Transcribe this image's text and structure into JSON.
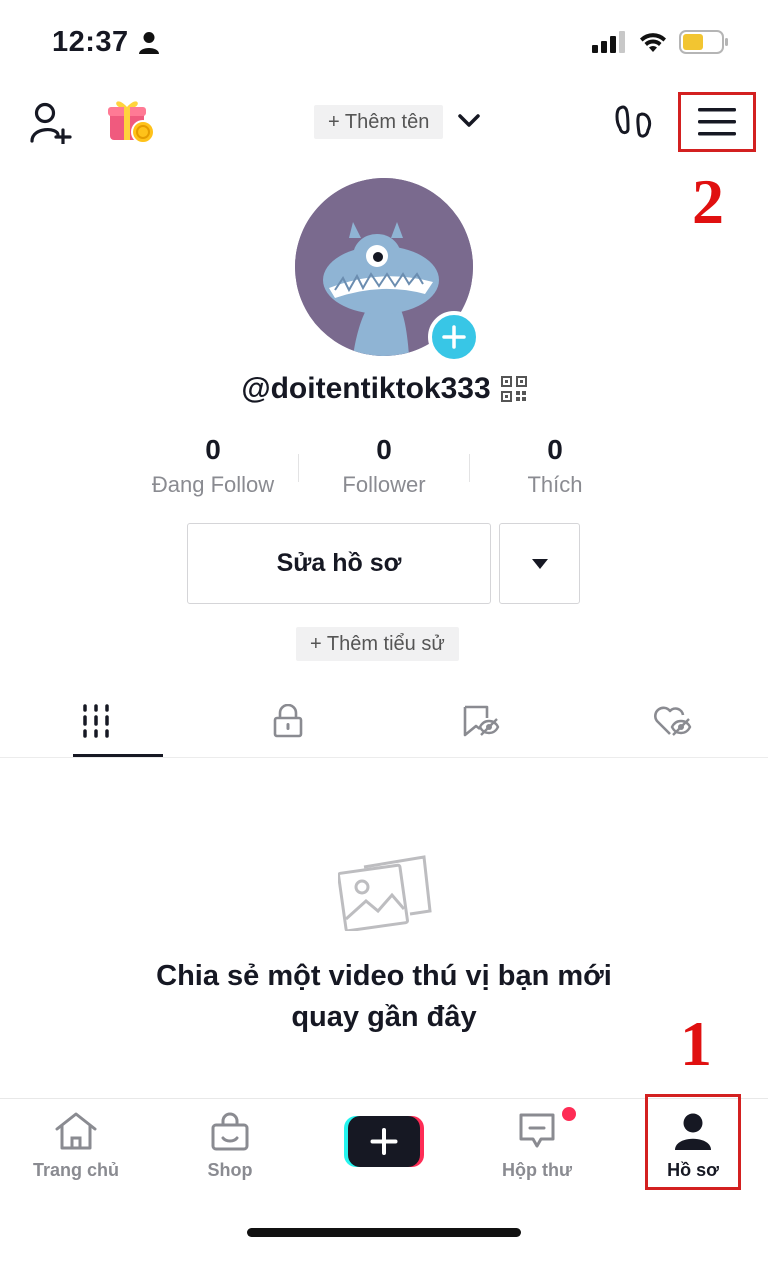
{
  "status_bar": {
    "time": "12:37"
  },
  "header": {
    "add_name_label": "+ Thêm tên",
    "annotation_menu": "2"
  },
  "profile": {
    "username": "@doitentiktok333",
    "stats": [
      {
        "value": "0",
        "label": "Đang Follow"
      },
      {
        "value": "0",
        "label": "Follower"
      },
      {
        "value": "0",
        "label": "Thích"
      }
    ],
    "edit_profile_label": "Sửa hồ sơ",
    "add_bio_label": "+ Thêm tiểu sử"
  },
  "tabs": [
    "videos-grid-icon",
    "lock-icon",
    "bookmark-hidden-icon",
    "liked-hidden-icon"
  ],
  "empty_state": {
    "line1": "Chia sẻ một video thú vị bạn mới",
    "line2": "quay gần đây"
  },
  "bottom_nav": {
    "home": "Trang chủ",
    "shop": "Shop",
    "inbox": "Hộp thư",
    "profile": "Hồ sơ",
    "annotation_profile": "1"
  },
  "colors": {
    "accent_blue": "#38c6e6",
    "annotation_red": "#d32020",
    "notification_dot": "#fe2c55",
    "avatar_bg": "#7a6a8e"
  }
}
